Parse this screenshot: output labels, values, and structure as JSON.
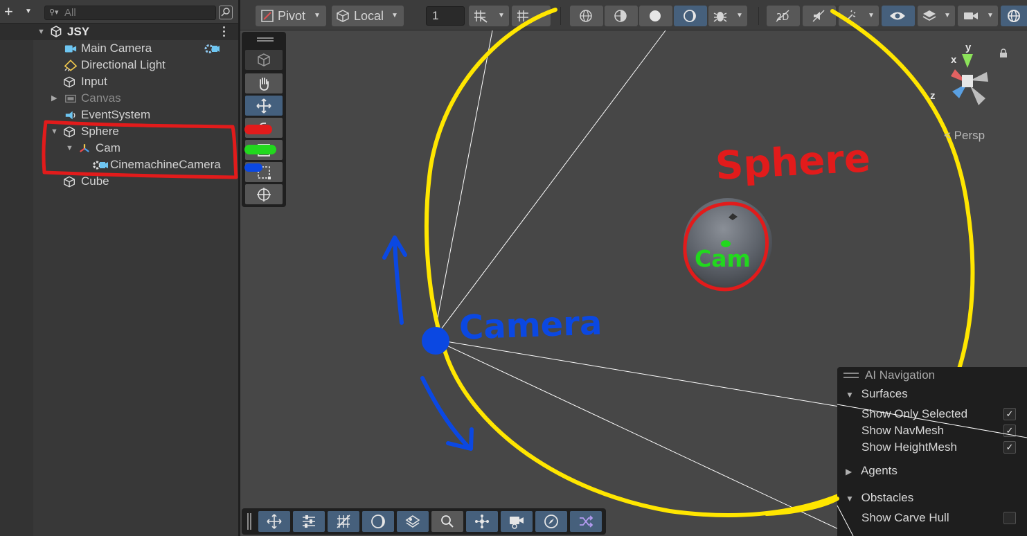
{
  "hierarchy": {
    "search_placeholder": "All",
    "scene_name": "JSY",
    "items": [
      {
        "label": "Main Camera"
      },
      {
        "label": "Directional Light"
      },
      {
        "label": "Input"
      },
      {
        "label": "Canvas"
      },
      {
        "label": "EventSystem"
      },
      {
        "label": "Sphere"
      },
      {
        "label": "Cam"
      },
      {
        "label": "CinemachineCamera"
      },
      {
        "label": "Cube"
      }
    ]
  },
  "scene_toolbar": {
    "pivot_label": "Pivot",
    "local_label": "Local",
    "grid_value": "1"
  },
  "gizmo": {
    "x": "x",
    "y": "y",
    "z": "z",
    "projection": "Persp"
  },
  "annotations": {
    "sphere": "Sphere",
    "cam": "Cam",
    "camera": "Camera"
  },
  "ai_navigation": {
    "title": "AI Navigation",
    "surfaces": "Surfaces",
    "show_only_selected": "Show Only Selected",
    "show_navmesh": "Show NavMesh",
    "show_heightmesh": "Show HeightMesh",
    "agents": "Agents",
    "obstacles": "Obstacles",
    "show_carve_hull": "Show Carve Hull"
  },
  "colors": {
    "annotation_red": "#e21b1b",
    "annotation_green": "#22d81e",
    "annotation_blue": "#0b48e2",
    "annotation_yellow": "#ffe600",
    "selection_blue": "#46607c"
  }
}
